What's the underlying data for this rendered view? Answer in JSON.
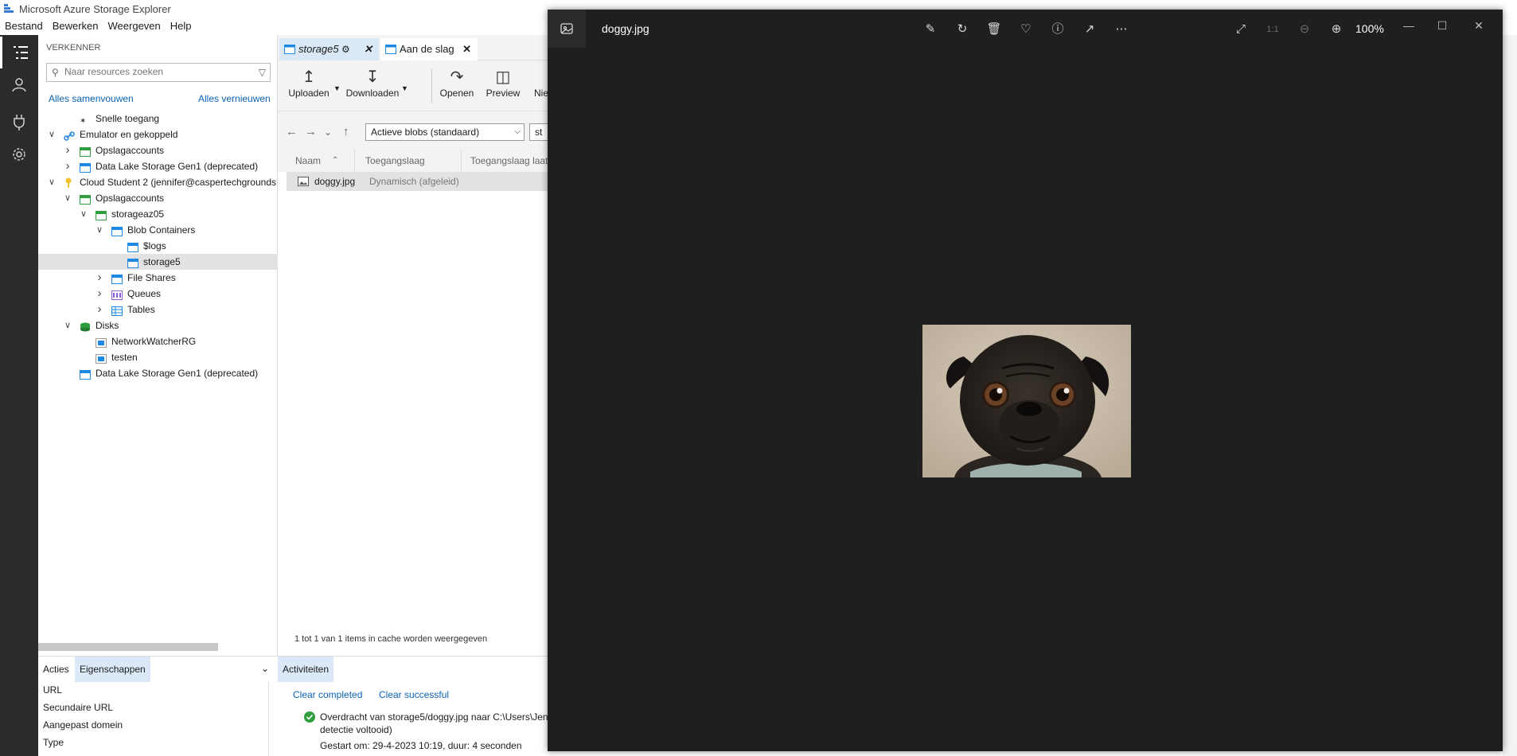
{
  "window": {
    "title": "Microsoft Azure Storage Explorer"
  },
  "menu": [
    "Bestand",
    "Bewerken",
    "Weergeven",
    "Help"
  ],
  "explorer": {
    "header": "VERKENNER",
    "search_placeholder": "Naar resources zoeken",
    "collapse_all": "Alles samenvouwen",
    "refresh_all": "Alles vernieuwen",
    "tree": [
      {
        "label": "Snelle toegang",
        "depth": 1,
        "chevron": "",
        "icon": "quick-access-icon"
      },
      {
        "label": "Emulator en gekoppeld",
        "depth": 0,
        "chevron": "open",
        "icon": "link-icon"
      },
      {
        "label": "Opslagaccounts",
        "depth": 1,
        "chevron": "closed",
        "icon": "storage-accounts-icon"
      },
      {
        "label": "Data Lake Storage Gen1 (deprecated)",
        "depth": 1,
        "chevron": "closed",
        "icon": "data-lake-icon"
      },
      {
        "label": "Cloud Student 2 (jennifer@caspertechgrounds",
        "depth": 0,
        "chevron": "open",
        "icon": "key-icon"
      },
      {
        "label": "Opslagaccounts",
        "depth": 1,
        "chevron": "open",
        "icon": "storage-accounts-icon"
      },
      {
        "label": "storageaz05",
        "depth": 2,
        "chevron": "open",
        "icon": "storage-account-icon"
      },
      {
        "label": "Blob Containers",
        "depth": 3,
        "chevron": "open",
        "icon": "blob-containers-icon"
      },
      {
        "label": "$logs",
        "depth": 4,
        "chevron": "",
        "icon": "container-icon"
      },
      {
        "label": "storage5",
        "depth": 4,
        "chevron": "",
        "icon": "container-icon",
        "selected": true
      },
      {
        "label": "File Shares",
        "depth": 3,
        "chevron": "closed",
        "icon": "file-shares-icon"
      },
      {
        "label": "Queues",
        "depth": 3,
        "chevron": "closed",
        "icon": "queues-icon"
      },
      {
        "label": "Tables",
        "depth": 3,
        "chevron": "closed",
        "icon": "tables-icon"
      },
      {
        "label": "Disks",
        "depth": 1,
        "chevron": "open",
        "icon": "disks-icon"
      },
      {
        "label": "NetworkWatcherRG",
        "depth": 2,
        "chevron": "",
        "icon": "resource-group-icon"
      },
      {
        "label": "testen",
        "depth": 2,
        "chevron": "",
        "icon": "resource-group-icon"
      },
      {
        "label": "Data Lake Storage Gen1 (deprecated)",
        "depth": 1,
        "chevron": "",
        "icon": "data-lake-icon"
      }
    ]
  },
  "tabs": [
    {
      "label": "storage5",
      "active": false
    },
    {
      "label": "Aan de slag",
      "active": true
    }
  ],
  "toolbar": {
    "upload": "Uploaden",
    "download": "Downloaden",
    "open": "Openen",
    "preview": "Preview",
    "new_truncated": "Nie"
  },
  "nav": {
    "blob_filter": "Actieve blobs (standaard)",
    "prefix_truncated": "st"
  },
  "columns": [
    "Naam",
    "Toegangslaag",
    "Toegangslaag laat"
  ],
  "files": [
    {
      "name": "doggy.jpg",
      "tier": "Dynamisch (afgeleid)"
    }
  ],
  "status_text": "1 tot 1 van 1 items in cache worden weergegeven",
  "bottom": {
    "tab_actions": "Acties",
    "tab_properties": "Eigenschappen",
    "properties": [
      "URL",
      "Secundaire URL",
      "Aangepast domein",
      "Type"
    ],
    "activities_tab": "Activiteiten",
    "clear_completed": "Clear completed",
    "clear_successful": "Clear successful",
    "transfer_line1": "Overdracht van storage5/doggy.jpg naar C:\\Users\\Jen",
    "transfer_line2": "detectie voltooid)",
    "transfer_line3": "Gestart om: 29-4-2023 10:19, duur: 4 seconden"
  },
  "viewer": {
    "filename": "doggy.jpg",
    "zoom": "100%",
    "icons": [
      "edit-icon",
      "rotate-icon",
      "delete-icon",
      "favorite-icon",
      "info-icon",
      "share-icon",
      "more-icon"
    ]
  },
  "colors": {
    "accent": "#0b63b5",
    "viewer_bg": "#1f1f1f",
    "activitybar": "#2b2b2b"
  }
}
